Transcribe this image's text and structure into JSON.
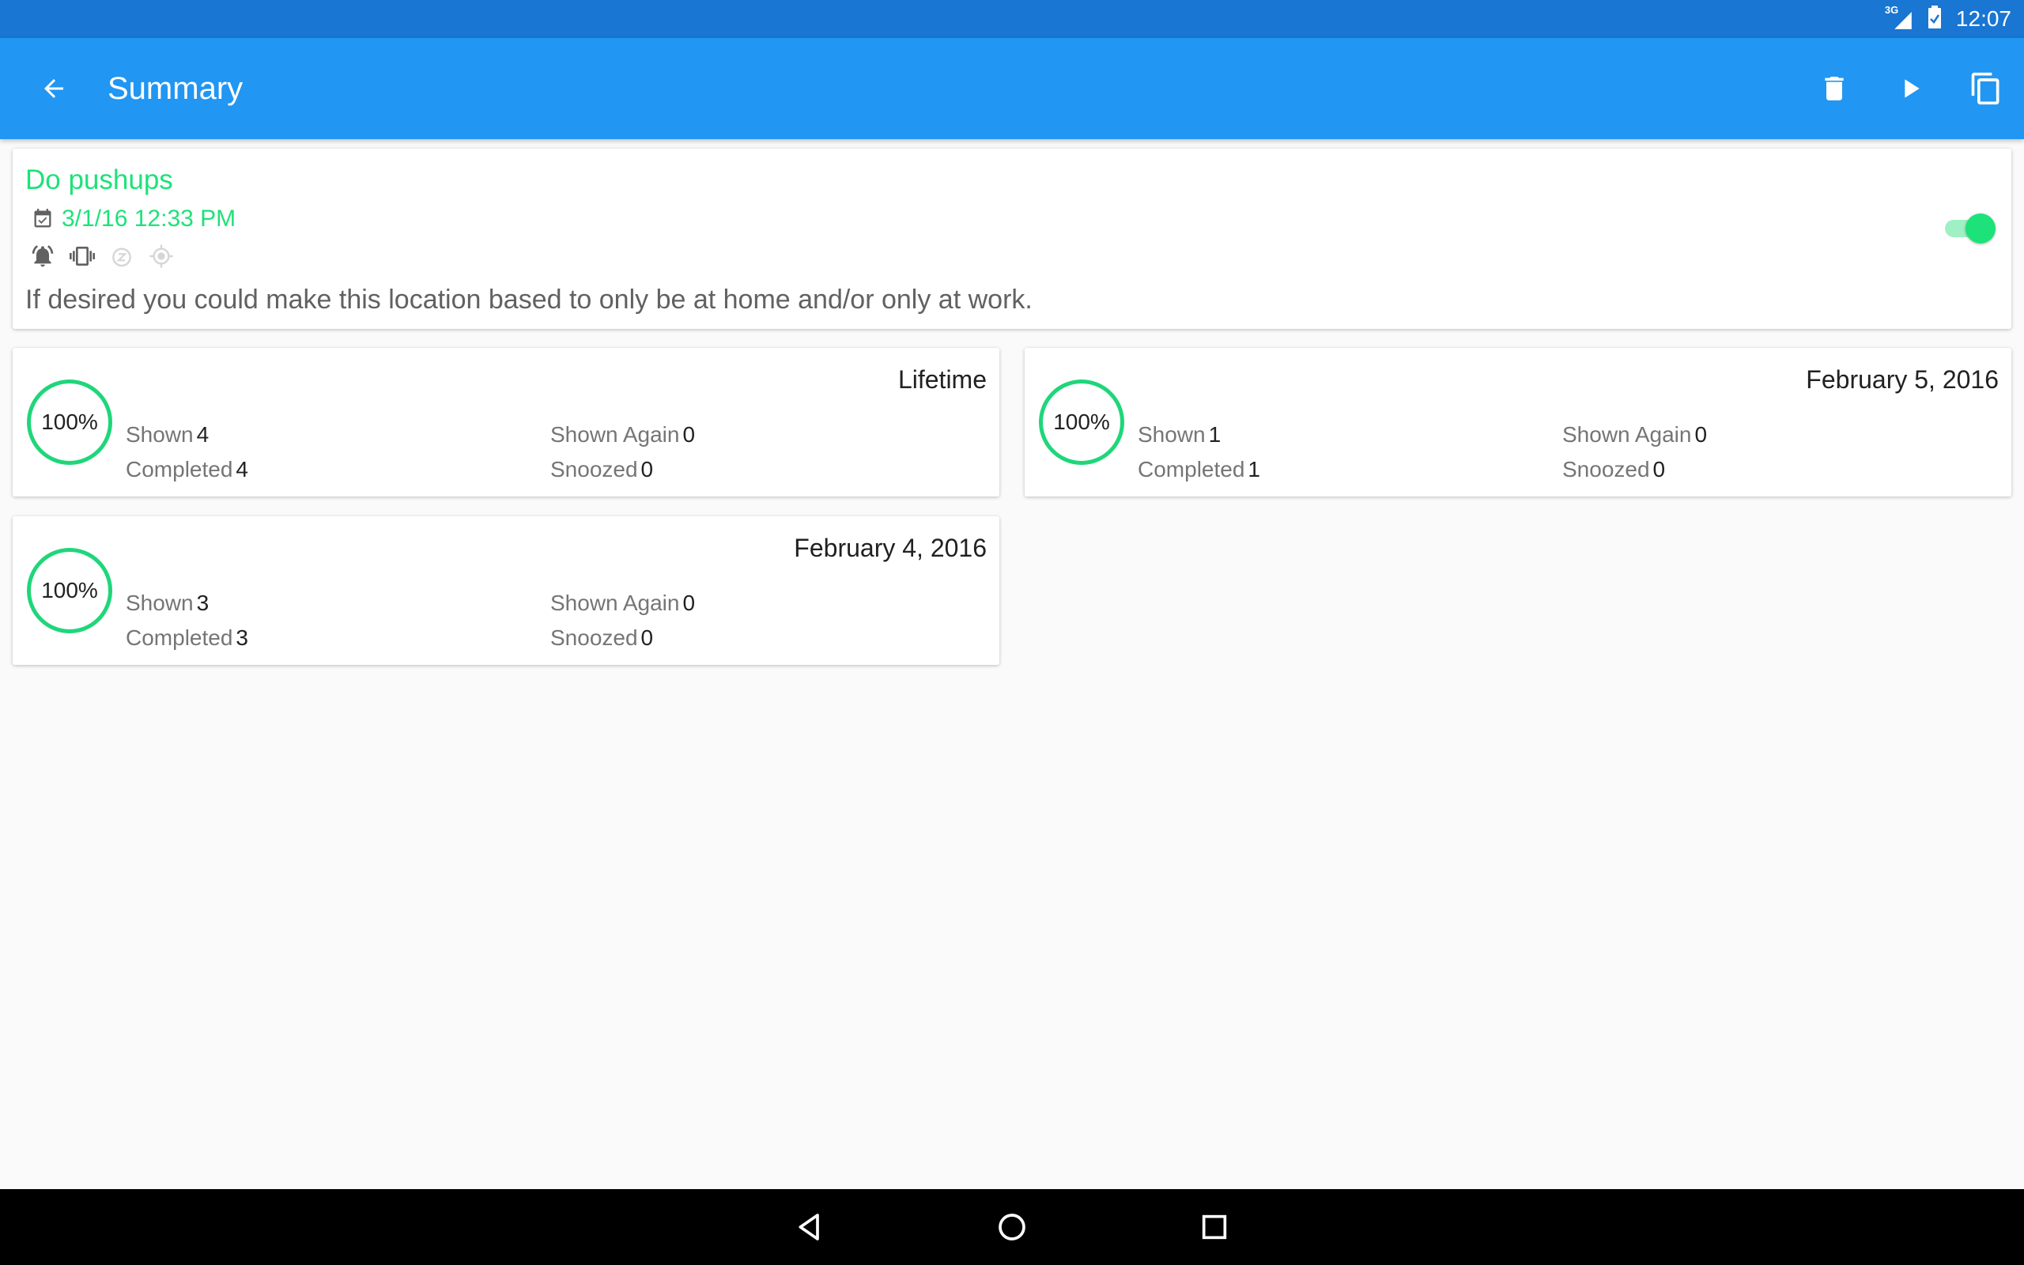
{
  "status_bar": {
    "time": "12:07",
    "network": "3G"
  },
  "app_bar": {
    "title": "Summary",
    "icons": [
      "back-arrow-icon",
      "trash-icon",
      "play-icon",
      "copy-icon"
    ]
  },
  "task": {
    "title": "Do pushups",
    "date": "3/1/16 12:33 PM",
    "description": "If desired you could make this location based to only be at home and/or only at work.",
    "enabled": true,
    "icons": [
      "alarm-bell-icon",
      "vibrate-icon",
      "snooze-icon",
      "location-icon"
    ]
  },
  "stats": [
    {
      "period": "Lifetime",
      "percent": "100%",
      "shown_label": "Shown",
      "shown": "4",
      "completed_label": "Completed",
      "completed": "4",
      "shown_again_label": "Shown Again",
      "shown_again": "0",
      "snoozed_label": "Snoozed",
      "snoozed": "0"
    },
    {
      "period": "February 5, 2016",
      "percent": "100%",
      "shown_label": "Shown",
      "shown": "1",
      "completed_label": "Completed",
      "completed": "1",
      "shown_again_label": "Shown Again",
      "shown_again": "0",
      "snoozed_label": "Snoozed",
      "snoozed": "0"
    },
    {
      "period": "February 4, 2016",
      "percent": "100%",
      "shown_label": "Shown",
      "shown": "3",
      "completed_label": "Completed",
      "completed": "3",
      "shown_again_label": "Shown Again",
      "shown_again": "0",
      "snoozed_label": "Snoozed",
      "snoozed": "0"
    }
  ],
  "colors": {
    "status_bar": "#1976d2",
    "app_bar": "#2196f3",
    "accent": "#1de27a"
  }
}
